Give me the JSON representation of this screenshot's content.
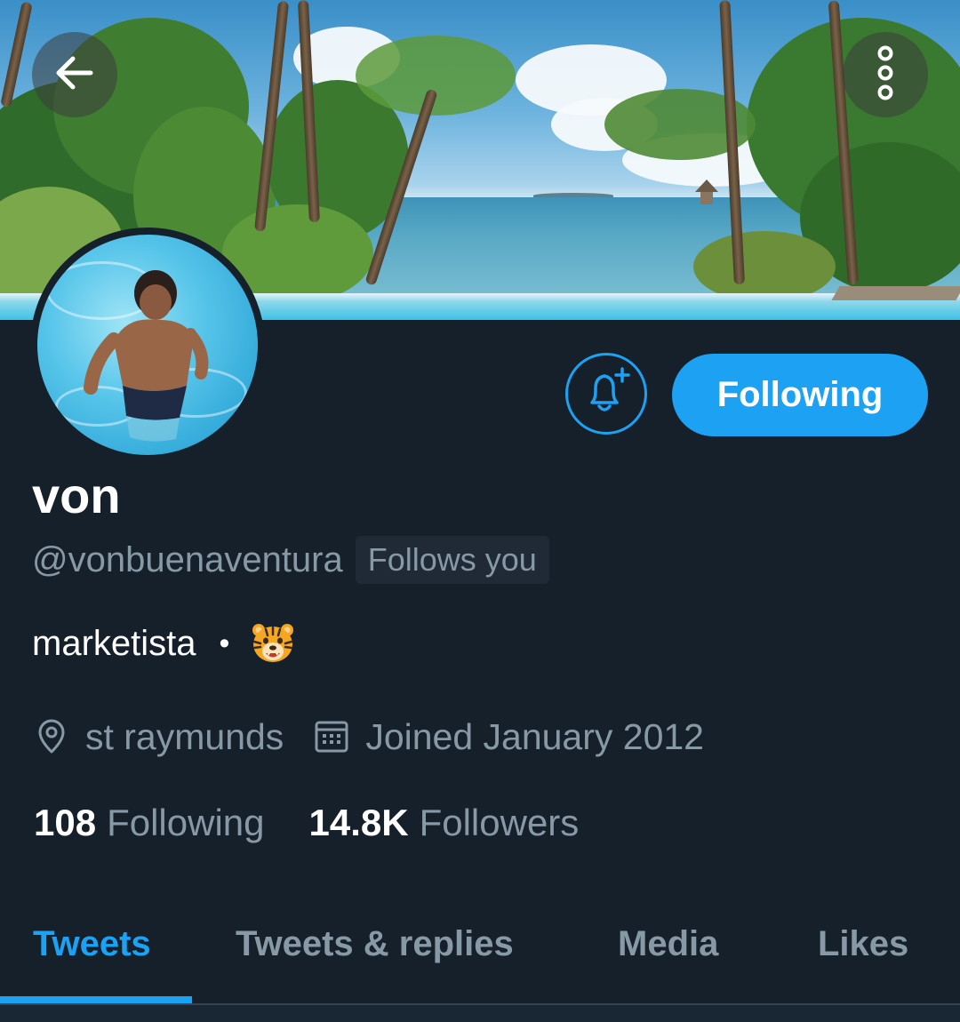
{
  "header": {
    "back_icon": "arrow-left-icon",
    "more_icon": "more-vertical-icon"
  },
  "profile": {
    "display_name": "von",
    "handle": "@vonbuenaventura",
    "follows_you": "Follows you",
    "bio_text": "marketista",
    "bio_separator": "•",
    "bio_emoji": "tiger-face-emoji",
    "location": "st raymunds",
    "joined": "Joined January 2012",
    "following_count": "108",
    "following_label": "Following",
    "followers_count": "14.8K",
    "followers_label": "Followers"
  },
  "actions": {
    "notify_icon": "bell-plus-icon",
    "follow_button_label": "Following"
  },
  "tabs": [
    {
      "label": "Tweets",
      "active": true
    },
    {
      "label": "Tweets & replies",
      "active": false
    },
    {
      "label": "Media",
      "active": false
    },
    {
      "label": "Likes",
      "active": false
    }
  ],
  "colors": {
    "background": "#15202b",
    "accent": "#1da1f2",
    "secondary_text": "#8899a6"
  }
}
